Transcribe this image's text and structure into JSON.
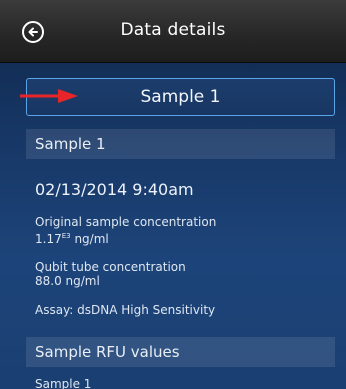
{
  "header": {
    "title": "Data details",
    "back_icon": "back-arrow-icon"
  },
  "sample_selector": {
    "label": "Sample 1"
  },
  "annotation": {
    "arrow_color": "#e8262a"
  },
  "details": {
    "section_title": "Sample 1",
    "datetime": "02/13/2014 9:40am",
    "original_label": "Original sample concentration",
    "original_value": "1.17",
    "original_exponent": "E3",
    "original_unit": "ng/ml",
    "tube_label": "Qubit tube concentration",
    "tube_value": "88.0 ng/ml",
    "assay": "Assay: dsDNA High Sensitivity"
  },
  "rfu": {
    "section_title": "Sample RFU values",
    "first_row": "Sample 1"
  }
}
